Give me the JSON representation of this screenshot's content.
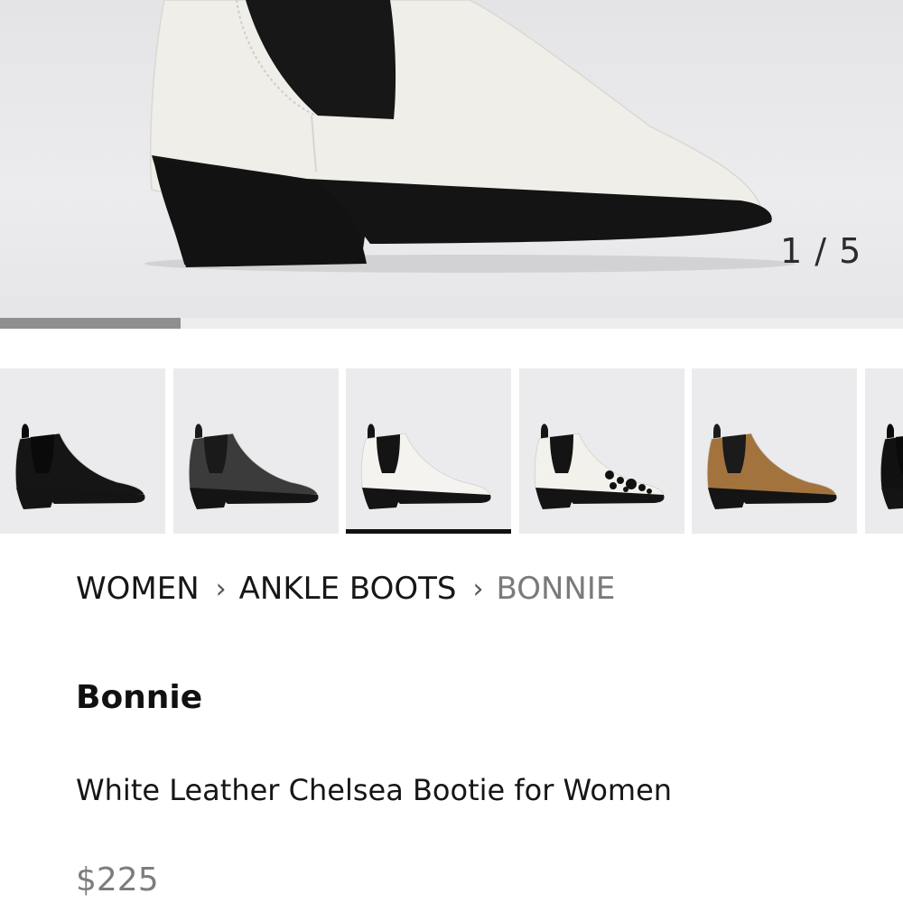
{
  "gallery": {
    "counter": "1 / 5",
    "current_index": 1,
    "total": 5,
    "progress": 0.2
  },
  "thumbnails": [
    {
      "name": "black leather boot",
      "upper": "#151515",
      "elastic": "#0a0a0a"
    },
    {
      "name": "dark grey boot",
      "upper": "#3b3b3b",
      "elastic": "#1a1a1a"
    },
    {
      "name": "white leather boot",
      "upper": "#f4f3ef",
      "elastic": "#141414",
      "selected": true
    },
    {
      "name": "black and white pattern boot",
      "upper": "#f2f1ec",
      "elastic": "#141414",
      "pattern": true
    },
    {
      "name": "tan suede boot",
      "upper": "#a3733e",
      "elastic": "#1b1b1b"
    },
    {
      "name": "black boot partial",
      "upper": "#111111",
      "elastic": "#0a0a0a"
    }
  ],
  "breadcrumb": {
    "level1": "WOMEN",
    "level2": "ANKLE BOOTS",
    "current": "BONNIE",
    "separator": "›"
  },
  "product": {
    "name": "Bonnie",
    "description": "White Leather Chelsea Bootie for Women",
    "price": "$225"
  },
  "colors": {
    "sole": "#141414",
    "hero_upper": "#efeee9"
  }
}
